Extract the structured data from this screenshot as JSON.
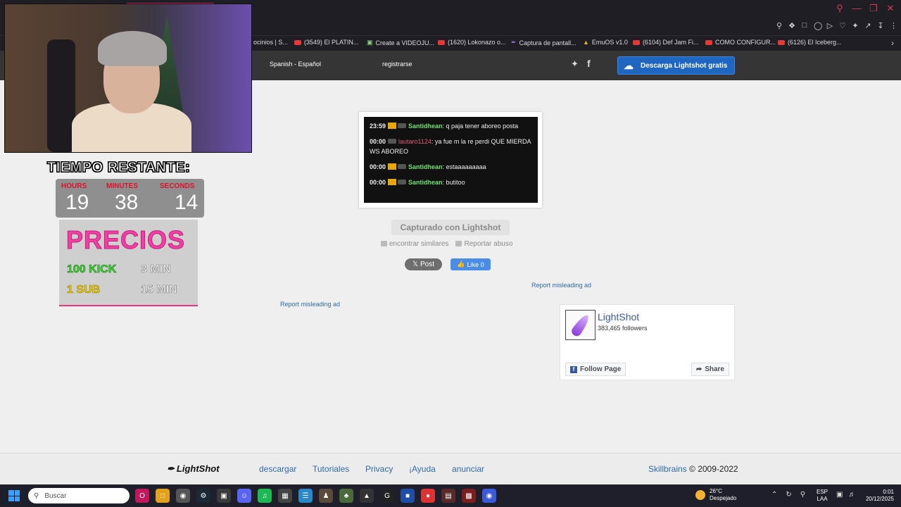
{
  "bookmarks": [
    {
      "label": "ocinios | S...",
      "icon": "page-icon"
    },
    {
      "label": "(3549) El PLATIN...",
      "icon": "youtube-icon"
    },
    {
      "label": "Create a VIDEOJU...",
      "icon": "doc-icon"
    },
    {
      "label": "(1620) Lokonazo o...",
      "icon": "youtube-icon"
    },
    {
      "label": "Captura de pantall...",
      "icon": "feather-icon"
    },
    {
      "label": "EmuOS v1.0",
      "icon": "gold-icon"
    },
    {
      "label": "(6104) Def Jam Fi...",
      "icon": "youtube-icon"
    },
    {
      "label": "COMO CONFIGUR...",
      "icon": "youtube-icon"
    },
    {
      "label": "(6126) El Iceberg...",
      "icon": "youtube-icon"
    }
  ],
  "site_header": {
    "language": "Spanish - Español",
    "register": "registrarse",
    "download_button": "Descarga Lightshot gratis"
  },
  "screenshot_chat": [
    {
      "time": "23:59",
      "user": "Santidhean",
      "text": ": q paja tener aboreo posta"
    },
    {
      "time": "00:00",
      "user": "lautaro1124",
      "text": ": ya fue m la re perdi QUE MIERDA WS ABOREO"
    },
    {
      "time": "00:00",
      "user": "Santidhean",
      "text": ": estaaaaaaaaa"
    },
    {
      "time": "00:00",
      "user": "Santidhean",
      "text": ": butitoo"
    }
  ],
  "captured_label": "Capturado con Lightshot",
  "find_similar": "encontrar similares",
  "report_abuse": "Reportar abuso",
  "x_post": "Post",
  "fb_like": "Like 0",
  "report_ad_1": "Report misleading ad",
  "report_ad_2": "Report misleading ad",
  "fb_widget": {
    "name": "LightShot",
    "followers": "383,465 followers",
    "follow_button": "Follow Page",
    "share_button": "Share"
  },
  "footer": {
    "logo": "LightShot",
    "links": [
      "descargar",
      "Tutoriales",
      "Privacy",
      "¡Ayuda",
      "anunciar"
    ],
    "company": "Skillbrains",
    "copyright": "© 2009-2022"
  },
  "overlay": {
    "timer_title": "TIEMPO RESTANTE:",
    "labels": {
      "hours": "HOURS",
      "minutes": "MINUTES",
      "seconds": "SECONDS"
    },
    "values": {
      "hours": "19",
      "minutes": "38",
      "seconds": "14"
    },
    "prices_title": "PRECIOS",
    "kick": "100 KICK",
    "kick_time": "3 MIN",
    "sub": "1 SUB",
    "sub_time": "15 MIN"
  },
  "taskbar": {
    "search_placeholder": "Buscar",
    "weather_temp": "26°C",
    "weather_desc": "Despejado",
    "lang_top": "ESP",
    "lang_bottom": "LAA",
    "time": "0:01",
    "date": "20/12/2025"
  },
  "colors": {
    "header_bg": "#353535",
    "download_button": "#1f66c1",
    "link": "#2f6aa8",
    "taskbar_bg": "#1f1f2b"
  }
}
